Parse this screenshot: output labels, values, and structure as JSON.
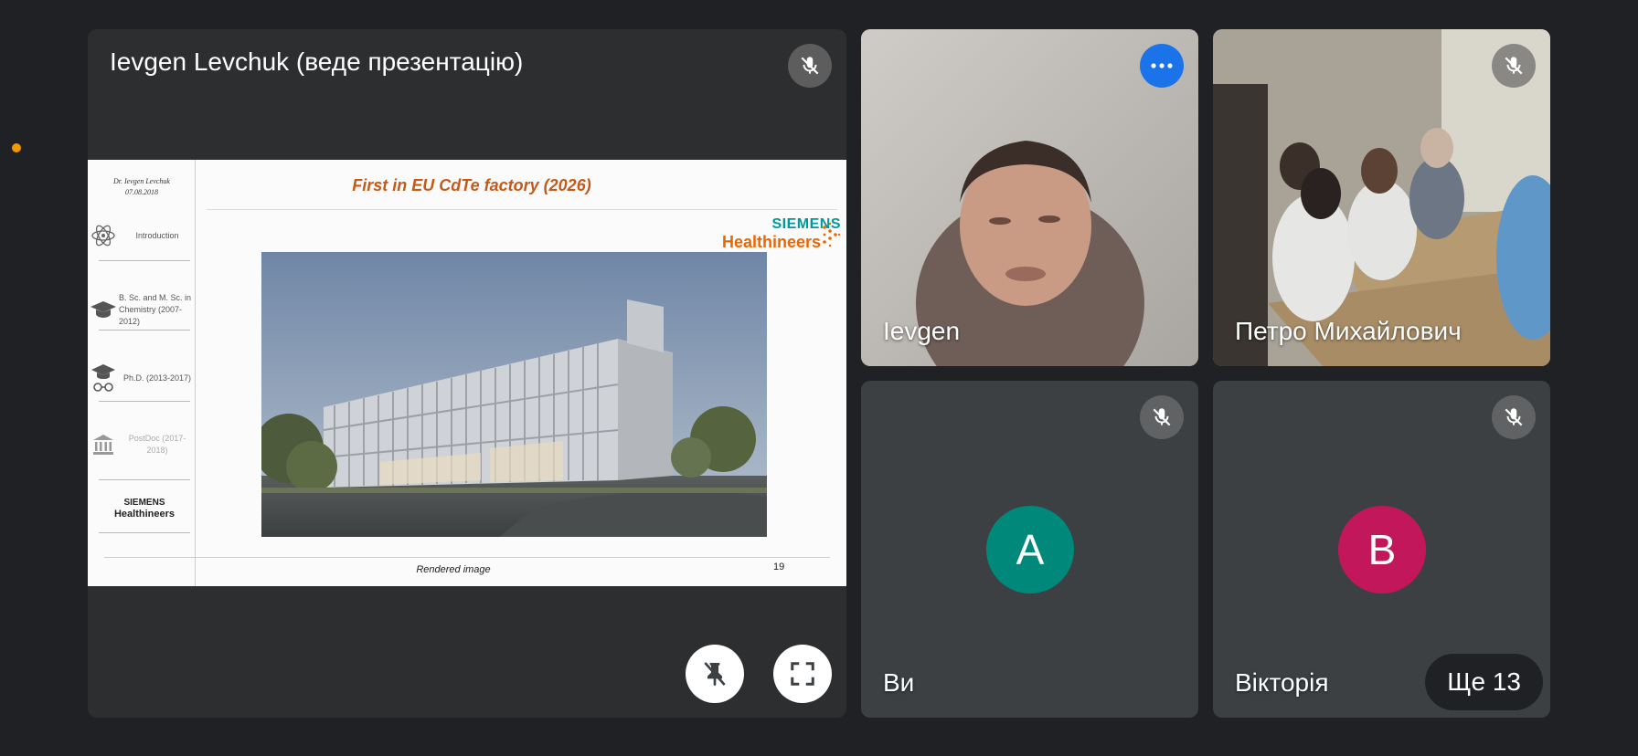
{
  "presenter": {
    "title": "Ievgen Levchuk (веде презентацію)"
  },
  "slide": {
    "author_name": "Dr. Ievgen Levchuk",
    "author_date": "07.08.2018",
    "nav": [
      {
        "label": "Introduction",
        "icon": "atom-icon"
      },
      {
        "label": "B. Sc. and M. Sc. in Chemistry (2007-2012)",
        "icon": "graduation-cap-icon"
      },
      {
        "label": "Ph.D. (2013-2017)",
        "icon": "graduate-glasses-icon"
      },
      {
        "label": "PostDoc (2017-2018)",
        "icon": "institution-icon"
      }
    ],
    "nav_logo_line1": "SIEMENS",
    "nav_logo_line2": "Healthineers",
    "title": "First in EU CdTe factory (2026)",
    "logo_line1": "SIEMENS",
    "logo_line2": "Healthineers",
    "caption": "Rendered image",
    "page_number": "19"
  },
  "participants": [
    {
      "name": "Ievgen"
    },
    {
      "name": "Петро Михайлович"
    },
    {
      "name": "Ви",
      "initial": "A",
      "color": "#00897b"
    },
    {
      "name": "Вікторія",
      "initial": "B",
      "color": "#c2185b"
    }
  ],
  "more_label": "Ще 13",
  "colors": {
    "background": "#202124",
    "tile": "#3c4043",
    "accent_blue": "#1a73e8",
    "title_orange": "#c45a19",
    "siemens_teal": "#009999",
    "healthineers_orange": "#ec6602"
  }
}
